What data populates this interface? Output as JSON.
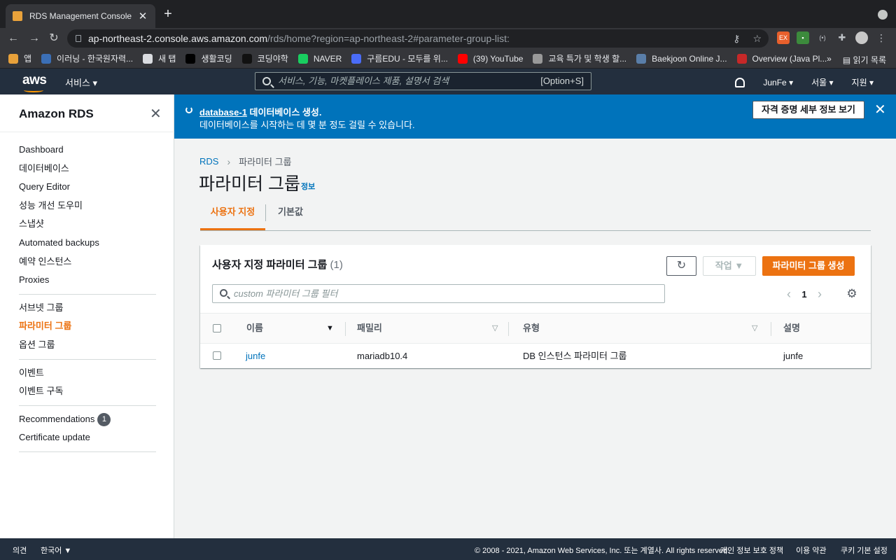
{
  "browser": {
    "tab_title": "RDS Management Console",
    "url_host": "ap-northeast-2.console.aws.amazon.com",
    "url_path": "/rds/home?region=ap-northeast-2#parameter-group-list:",
    "bookmarks": [
      {
        "label": "앱",
        "color": "#e8a13a"
      },
      {
        "label": "이러닝 - 한국원자력...",
        "color": "#3b6fb6"
      },
      {
        "label": "새 탭",
        "color": "#dadce0"
      },
      {
        "label": "생활코딩",
        "color": "#000000"
      },
      {
        "label": "코딩야학",
        "color": "#111111"
      },
      {
        "label": "NAVER",
        "color": "#19ce60"
      },
      {
        "label": "구름EDU - 모두를 위...",
        "color": "#4a6cf7"
      },
      {
        "label": "(39) YouTube",
        "color": "#ff0000"
      },
      {
        "label": "교육 특가 및 학생 할...",
        "color": "#999999"
      },
      {
        "label": "Baekjoon Online J...",
        "color": "#5a7ea8"
      },
      {
        "label": "Overview (Java Pl...",
        "color": "#c62828"
      }
    ],
    "bookmarks_more": "»",
    "reading_list": "읽기 목록"
  },
  "header": {
    "logo": "aws",
    "services": "서비스",
    "search_placeholder": "서비스, 기능, 마켓플레이스 제품, 설명서 검색",
    "search_shortcut": "[Option+S]",
    "user": "JunFe",
    "region": "서울",
    "support": "지원"
  },
  "sidebar": {
    "title": "Amazon RDS",
    "groups": [
      [
        "Dashboard",
        "데이터베이스",
        "Query Editor",
        "성능 개선 도우미",
        "스냅샷",
        "Automated backups",
        "예약 인스턴스",
        "Proxies"
      ],
      [
        "서브넷 그룹",
        "파라미터 그룹",
        "옵션 그룹"
      ],
      [
        "이벤트",
        "이벤트 구독"
      ],
      [
        "Recommendations",
        "Certificate update"
      ]
    ],
    "active": "파라미터 그룹",
    "recommendations_badge": "1"
  },
  "flash": {
    "db_link": "database-1",
    "line1_suffix": " 데이터베이스 생성.",
    "line2": "데이터베이스를 시작하는 데 몇 분 정도 걸릴 수 있습니다.",
    "button": "자격 증명 세부 정보 보기"
  },
  "main": {
    "breadcrumb_root": "RDS",
    "breadcrumb_current": "파라미터 그룹",
    "title": "파라미터 그룹",
    "info": "정보",
    "tabs": [
      "사용자 지정",
      "기본값"
    ],
    "active_tab": "사용자 지정"
  },
  "panel": {
    "title": "사용자 지정 파라미터 그룹",
    "count": "(1)",
    "actions": "작업",
    "create": "파라미터 그룹 생성",
    "filter_placeholder": "custom 파라미터 그룹 필터",
    "page": "1",
    "columns": [
      "이름",
      "패밀리",
      "유형",
      "설명"
    ],
    "rows": [
      {
        "name": "junfe",
        "family": "mariadb10.4",
        "type": "DB 인스턴스 파라미터 그룹",
        "description": "junfe"
      }
    ]
  },
  "footer": {
    "feedback": "의견",
    "language": "한국어",
    "copyright": "© 2008 - 2021, Amazon Web Services, Inc. 또는 계열사. All rights reserved.",
    "privacy": "개인 정보 보호 정책",
    "terms": "이용 약관",
    "cookies": "쿠키 기본 설정"
  }
}
